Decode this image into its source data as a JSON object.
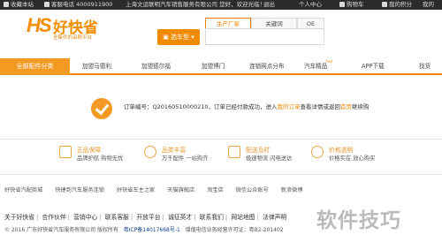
{
  "topbar": {
    "favorite": "收藏本站",
    "hotline": "客服电话 4000911900",
    "company_welcome": "上海文运联明汽车销售服务有限公司 您好，欢迎光临！",
    "logout": "退出",
    "user_center": "个人中心",
    "cart": "购物车",
    "my_points": "我的积分",
    "my": "我的"
  },
  "header": {
    "logo_mark": "HS",
    "logo_name": "好快省",
    "slogan": "全集件的采购平台",
    "tabs": [
      "生产厂家",
      "关键词",
      "OE"
    ],
    "store_button": "选车型"
  },
  "nav": {
    "all_categories": "全部配件分类",
    "items": [
      "加盟马德利",
      "加盟德尔福",
      "加盟博门",
      "连锁网点分布",
      "汽车精品",
      "APP下载",
      "找货"
    ],
    "hot_label": "hot"
  },
  "success": {
    "line_prefix": "订单编号：",
    "order_number": "Q20160510000210",
    "line_middle": "，订单已经付款成功，进入",
    "my_orders": "我的订单",
    "line_view": "查看详情或",
    "back_to": "返回",
    "home_link": "首页",
    "continue": "继续购"
  },
  "features": [
    {
      "title": "正品保障",
      "desc": "品牌护航 购物无忧",
      "icon": "shield-icon"
    },
    {
      "title": "品类丰富",
      "desc": "万千配件 一站购齐",
      "icon": "box-icon"
    },
    {
      "title": "配送及时",
      "desc": "极速物流 闪电送达",
      "icon": "truck-icon"
    },
    {
      "title": "价格透明",
      "desc": "价格实在 放心购买",
      "icon": "price-tag-icon"
    }
  ],
  "partners": [
    "好快省汽配商城",
    "快捷到汽车服务连锁",
    "好快省车主之家",
    "天猫旗舰店",
    "淘宝店",
    "微信公众账号",
    "新浪微博"
  ],
  "footer": {
    "links": [
      "关于好快省",
      "合作伙伴",
      "营销中心",
      "联系客服",
      "开放平台",
      "诚征英才",
      "联系我们",
      "网站地图",
      "法律声明"
    ],
    "copyright": "© 2016 广东好快省汽车服务有限公司 版权所有",
    "icp": "粤ICP备14017668号-1",
    "telecom": "增值电信业务经营许可证：粤B2-201402"
  },
  "watermark": "软件技巧"
}
